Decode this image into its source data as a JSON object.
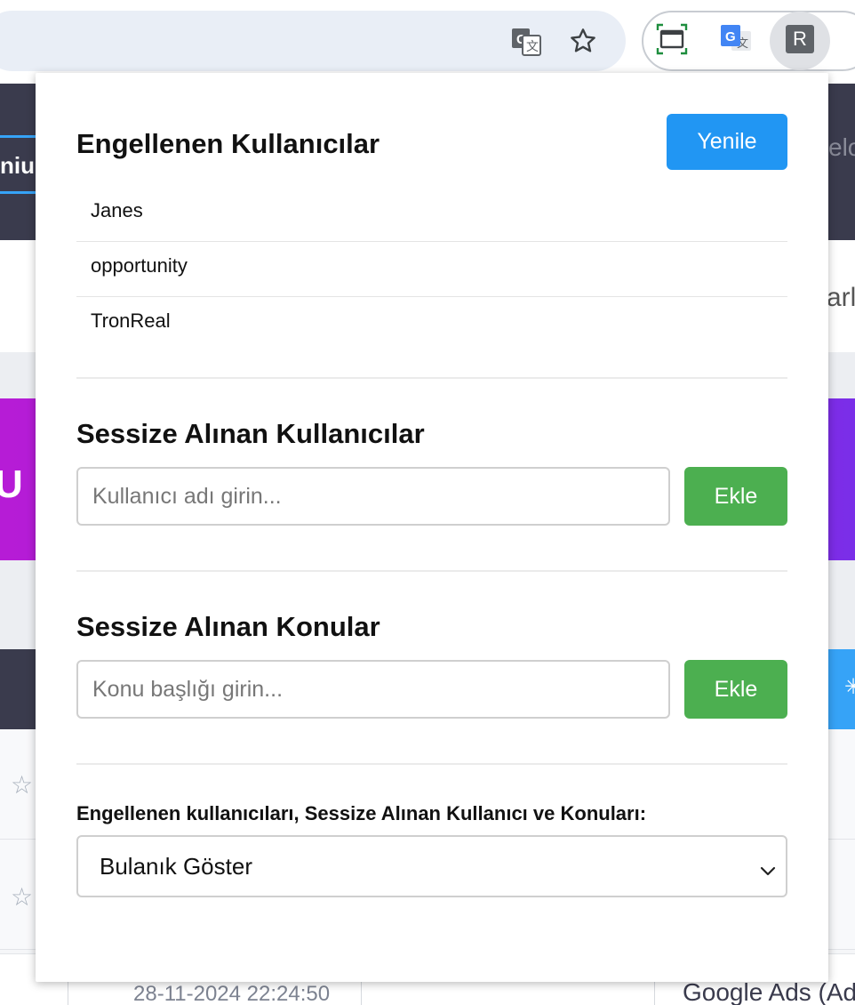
{
  "browser": {
    "omnibox_icons": [
      "translate-icon",
      "bookmark-star-icon"
    ],
    "extension_icons": [
      "screenshot-icon",
      "google-translate-icon",
      "r-extension-icon"
    ],
    "r_extension_letter": "R"
  },
  "background_page": {
    "nav_tab_text": "niu",
    "nav_right_text": "elo",
    "right_text": "arl",
    "banner_text": "U",
    "row_date": "28-11-2024 22:24:50",
    "row_right_text": "Google Ads (Ad"
  },
  "popup": {
    "blocked_users": {
      "title": "Engellenen Kullanıcılar",
      "refresh_label": "Yenile",
      "items": [
        "Janes",
        "opportunity",
        "TronReal"
      ]
    },
    "muted_users": {
      "title": "Sessize Alınan Kullanıcılar",
      "input_placeholder": "Kullanıcı adı girin...",
      "input_value": "",
      "add_label": "Ekle"
    },
    "muted_topics": {
      "title": "Sessize Alınan Konular",
      "input_placeholder": "Konu başlığı girin...",
      "input_value": "",
      "add_label": "Ekle"
    },
    "display_mode": {
      "label": "Engellenen kullanıcıları, Sessize Alınan Kullanıcı ve Konuları:",
      "selected": "Bulanık Göster"
    }
  },
  "colors": {
    "primary_blue": "#2196f3",
    "add_green": "#4caf50",
    "nav_dark": "#3a3b4d",
    "banner_purple": "#b61cd6"
  }
}
